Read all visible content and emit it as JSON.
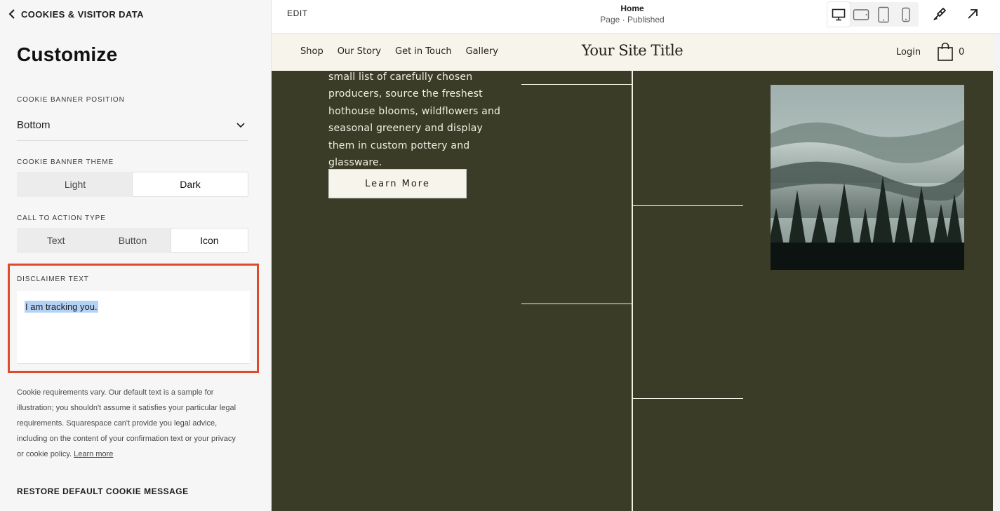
{
  "sidebar": {
    "back_label": "COOKIES & VISITOR DATA",
    "title": "Customize",
    "position": {
      "label": "COOKIE BANNER POSITION",
      "value": "Bottom"
    },
    "theme": {
      "label": "COOKIE BANNER THEME",
      "options": [
        "Light",
        "Dark"
      ],
      "selected": "Dark"
    },
    "cta": {
      "label": "CALL TO ACTION TYPE",
      "options": [
        "Text",
        "Button",
        "Icon"
      ],
      "selected": "Icon"
    },
    "disclaimer": {
      "label": "DISCLAIMER TEXT",
      "value": "I am tracking you."
    },
    "note": "Cookie requirements vary. Our default text is a sample for illustration; you shouldn't assume it satisfies your particular legal requirements. Squarespace can't provide you legal advice, including on the content of your confirmation text or your privacy or cookie policy.",
    "note_link": "Learn more",
    "restore_label": "RESTORE DEFAULT COOKIE MESSAGE"
  },
  "toolbar": {
    "edit_label": "EDIT",
    "page_name": "Home",
    "page_status": "Page · Published",
    "devices": [
      "desktop-icon",
      "tablet-landscape-icon",
      "tablet-portrait-icon",
      "mobile-icon"
    ],
    "selected_device": "desktop-icon"
  },
  "site": {
    "nav": [
      "Shop",
      "Our Story",
      "Get in Touch",
      "Gallery"
    ],
    "title": "Your Site Title",
    "login": "Login",
    "cart_count": "0",
    "body_text": "small list of carefully chosen producers, source the freshest hothouse blooms, wildflowers and seasonal greenery and display them in custom pottery and glassware.",
    "button_label": "Learn More"
  },
  "colors": {
    "accent_outline": "#e04a2c",
    "preview_bg": "#3a3c27",
    "nav_bg": "#f7f4ec",
    "selection": "#b4d2f6"
  }
}
